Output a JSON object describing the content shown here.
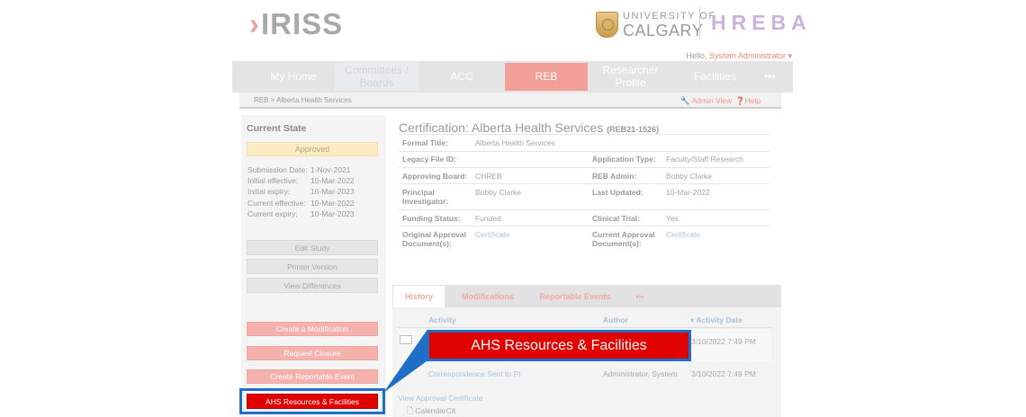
{
  "header": {
    "app_logo": "IRISS",
    "university_line1": "UNIVERSITY OF",
    "university_line2": "CALGARY",
    "board_logo": "HREBA",
    "greeting": "Hello,",
    "user": "System Administrator"
  },
  "nav": {
    "items": [
      {
        "label": "My Home"
      },
      {
        "label": "Committees / Boards"
      },
      {
        "label": "ACC"
      },
      {
        "label": "REB"
      },
      {
        "label": "Researcher Profile"
      },
      {
        "label": "Facilities"
      },
      {
        "label": "•••"
      }
    ]
  },
  "breadcrumb": {
    "path": "REB  >  Alberta Health Services",
    "admin_view": "Admin View",
    "help": "Help"
  },
  "left": {
    "title": "Current State",
    "status": "Approved",
    "dates": [
      {
        "label": "Submission Date:",
        "value": "1-Nov-2021"
      },
      {
        "label": "Initial effective:",
        "value": "10-Mar-2022"
      },
      {
        "label": "Initial expiry:",
        "value": "10-Mar-2023"
      },
      {
        "label": "Current effective:",
        "value": "10-Mar-2022"
      },
      {
        "label": "Current expiry:",
        "value": "10-Mar-2023"
      }
    ],
    "buttons": {
      "edit_study": "Edit Study",
      "printer_version": "Printer Version",
      "view_differences": "View Differences",
      "create_modification": "Create a Modification",
      "request_closure": "Request Closure",
      "create_reportable_event": "Create Reportable Event",
      "ahs_resources": "AHS Resources & Facilities"
    }
  },
  "certification": {
    "title": "Certification: Alberta Health Services",
    "number": "(REB21-1526)",
    "formal_title_label": "Formal Title:",
    "formal_title": "Alberta Health Services",
    "legacy_label": "Legacy File ID:",
    "legacy_value": "",
    "application_type_label": "Application Type:",
    "application_type": "Faculty/Staff Research",
    "approving_board_label": "Approving Board:",
    "approving_board": "CHREB",
    "reb_admin_label": "REB Admin:",
    "reb_admin": "Bobby Clarke",
    "pi_label_1": "Principal",
    "pi_label_2": "Investigator:",
    "pi": "Bobby Clarke",
    "last_updated_label": "Last Updated:",
    "last_updated": "10-Mar-2022",
    "funding_label": "Funding Status:",
    "funding": "Funded",
    "clinical_trial_label": "Clinical Trial:",
    "clinical_trial": "Yes",
    "orig_doc_label_1": "Original Approval",
    "orig_doc_label_2": "Document(s):",
    "orig_doc": "Certificate",
    "curr_doc_label_1": "Current Approval",
    "curr_doc_label_2": "Document(s):",
    "curr_doc": "Certificate"
  },
  "tabs": [
    {
      "label": "History"
    },
    {
      "label": "Modifications"
    },
    {
      "label": "Reportable Events"
    },
    {
      "label": "•••"
    }
  ],
  "history": {
    "col_activity": "Activity",
    "col_author": "Author",
    "col_date": "▾ Activity Date",
    "rows": [
      {
        "activity": "",
        "author": "",
        "date": "3/10/2022 7:49 PM"
      },
      {
        "activity": "Correspondence Sent to PI",
        "author": "Administrator, System",
        "date": "3/10/2022 7:49 PM"
      }
    ],
    "view_certificate": "View Approval Certificate",
    "file_label": "CalendarCit"
  },
  "callout": {
    "text": "AHS Resources & Facilities"
  },
  "colors": {
    "accent": "#f29f98",
    "highlight_red": "#e00000",
    "highlight_blue": "#1f6fc9"
  }
}
